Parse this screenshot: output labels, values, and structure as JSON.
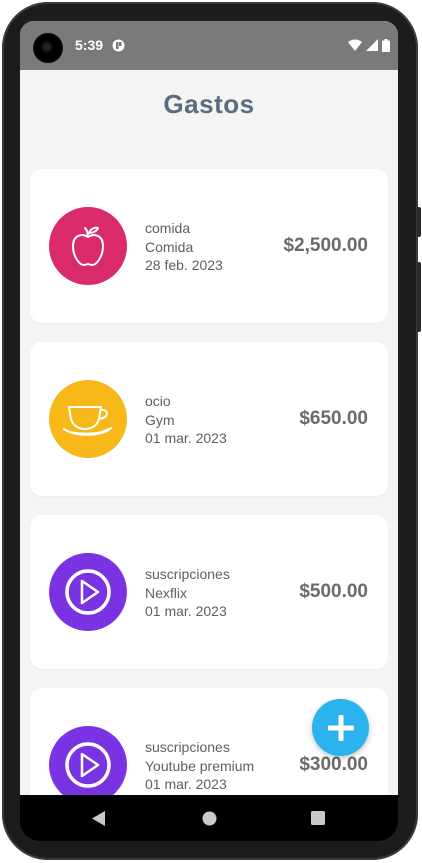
{
  "status_bar": {
    "time": "5:39",
    "icons": [
      "notification-icon",
      "wifi-icon",
      "signal-icon",
      "battery-icon"
    ]
  },
  "app": {
    "title": "Gastos"
  },
  "expenses": [
    {
      "category": "comida",
      "description": "Comida",
      "date": "28 feb. 2023",
      "amount": "$2,500.00",
      "icon": "apple-icon",
      "color": "#db2a6b"
    },
    {
      "category": "ocio",
      "description": "Gym",
      "date": "01 mar. 2023",
      "amount": "$650.00",
      "icon": "coffee-cup-icon",
      "color": "#f8b81a"
    },
    {
      "category": "suscripciones",
      "description": "Nexflix",
      "date": "01 mar. 2023",
      "amount": "$500.00",
      "icon": "play-icon",
      "color": "#7a33e3"
    },
    {
      "category": "suscripciones",
      "description": "Youtube premium",
      "date": "01 mar. 2023",
      "amount": "$300.00",
      "icon": "play-icon",
      "color": "#7a33e3"
    }
  ],
  "fab": {
    "icon": "plus-icon",
    "color": "#2bb3ee"
  },
  "nav_bar": {
    "buttons": [
      "back-icon",
      "home-icon",
      "recents-icon"
    ]
  }
}
